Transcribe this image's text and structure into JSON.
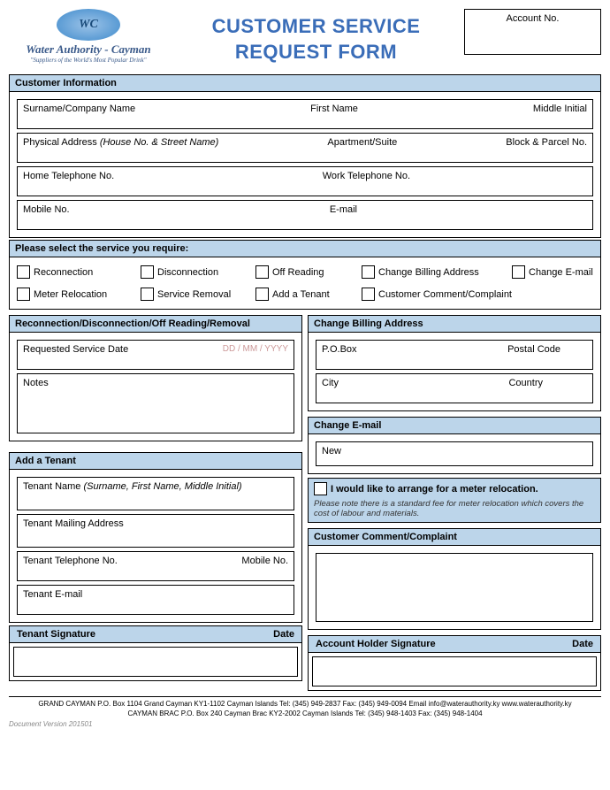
{
  "header": {
    "logo_text": "WC",
    "org": "Water Authority - Cayman",
    "tagline": "\"Suppliers of the World's Most Popular Drink\"",
    "title_l1": "CUSTOMER SERVICE",
    "title_l2": "REQUEST FORM",
    "account_label": "Account No."
  },
  "customer": {
    "title": "Customer Information",
    "surname": "Surname/Company Name",
    "first": "First Name",
    "middle": "Middle Initial",
    "addr": "Physical Address ",
    "addr_hint": "(House No. & Street Name)",
    "apt": "Apartment/Suite",
    "block": "Block & Parcel No.",
    "home_tel": "Home Telephone No.",
    "work_tel": "Work Telephone No.",
    "mobile": "Mobile No.",
    "email": "E-mail"
  },
  "service": {
    "title": "Please select the service you require:",
    "opts": [
      "Reconnection",
      "Disconnection",
      "Off Reading",
      "Change Billing Address",
      "Change E-mail",
      "Meter Relocation",
      "Service Removal",
      "Add a Tenant",
      "Customer Comment/Complaint"
    ]
  },
  "recon": {
    "title": "Reconnection/Disconnection/Off Reading/Removal",
    "req_date": "Requested Service Date",
    "date_fmt": "DD / MM / YYYY",
    "notes": "Notes"
  },
  "billing": {
    "title": "Change Billing Address",
    "pobox": "P.O.Box",
    "postal": "Postal Code",
    "city": "City",
    "country": "Country"
  },
  "email_change": {
    "title": "Change E-mail",
    "new": "New"
  },
  "tenant": {
    "title": "Add a Tenant",
    "name": "Tenant Name ",
    "name_hint": "(Surname, First Name, Middle Initial)",
    "mail": "Tenant Mailing Address",
    "tel": "Tenant Telephone No.",
    "mobile": "Mobile No.",
    "email": "Tenant E-mail"
  },
  "meter": {
    "label": "I would like to arrange for a meter relocation.",
    "note": "Please note there is a standard fee for meter relocation which covers the cost of labour and materials."
  },
  "comment": {
    "title": "Customer Comment/Complaint"
  },
  "sig": {
    "tenant": "Tenant Signature",
    "holder": "Account Holder Signature",
    "date": "Date"
  },
  "footer": {
    "l1": "GRAND CAYMAN P.O. Box 1104 Grand Cayman KY1-1102 Cayman Islands Tel: (345) 949-2837 Fax: (345) 949-0094 Email info@waterauthority.ky www.waterauthority.ky",
    "l2": "CAYMAN BRAC P.O. Box 240 Cayman Brac KY2-2002 Cayman Islands Tel: (345) 948-1403 Fax: (345) 948-1404",
    "ver": "Document Version 201501"
  }
}
